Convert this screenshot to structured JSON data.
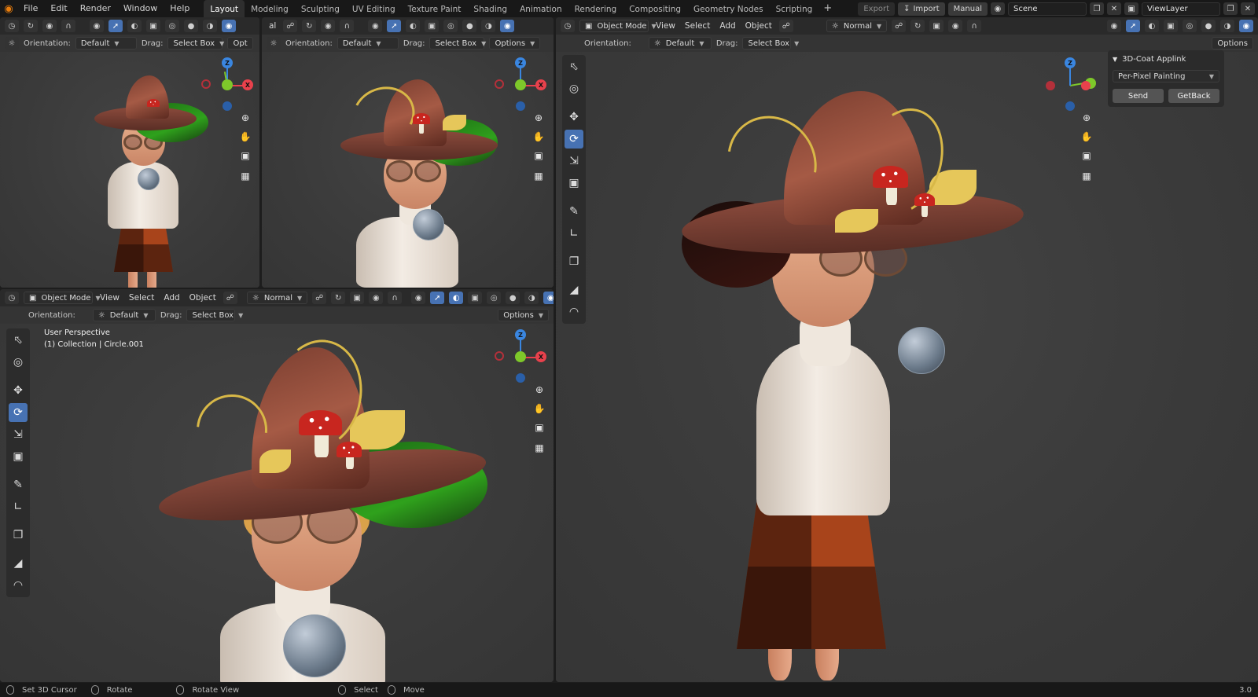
{
  "topbar": {
    "menus": [
      "File",
      "Edit",
      "Render",
      "Window",
      "Help"
    ],
    "workspaces": [
      "Layout",
      "Modeling",
      "Sculpting",
      "UV Editing",
      "Texture Paint",
      "Shading",
      "Animation",
      "Rendering",
      "Compositing",
      "Geometry Nodes",
      "Scripting"
    ],
    "active_workspace": "Layout",
    "add_tab": "+",
    "export_label": "Export",
    "import_label": "Import",
    "manual_label": "Manual",
    "scene_value": "Scene",
    "viewlayer_value": "ViewLayer"
  },
  "header": {
    "object_mode": "Object Mode",
    "view": "View",
    "select": "Select",
    "add": "Add",
    "object": "Object",
    "normal": "Normal",
    "orientation_label": "Orientation:",
    "orientation_value": "Default",
    "drag_label": "Drag:",
    "drag_value": "Select Box",
    "options_label": "Options",
    "options_clipped": "Opt",
    "clipped_al": "al"
  },
  "viewport_bl": {
    "perspective_text": "User Perspective",
    "collection_text": "(1) Collection | Circle.001"
  },
  "gizmo": {
    "x": "X",
    "y": "Y",
    "z": "Z"
  },
  "npanel": {
    "title": "3D-Coat Applink",
    "mode_value": "Per-Pixel Painting",
    "send_label": "Send",
    "getback_label": "GetBack"
  },
  "status": {
    "set_cursor": "Set 3D Cursor",
    "rotate": "Rotate",
    "rotate_view": "Rotate View",
    "select": "Select",
    "move": "Move",
    "version": "3.0"
  },
  "colors": {
    "accent_blue": "#4772b3",
    "axis_x": "#e8414c",
    "axis_y": "#7ec82a",
    "axis_z": "#3a86e0",
    "blender_orange": "#e87d0d"
  }
}
